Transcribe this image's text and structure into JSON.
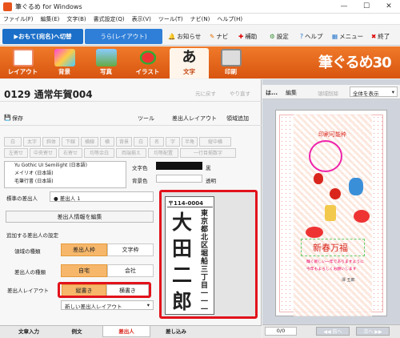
{
  "window": {
    "title": "筆ぐるめ for Windows",
    "min": "—",
    "max": "☐",
    "close": "✕"
  },
  "menu": [
    "ファイル(F)",
    "編集(E)",
    "文字(B)",
    "書式設定(Q)",
    "表示(V)",
    "ツール(T)",
    "ナビ(N)",
    "ヘルプ(H)"
  ],
  "modes": {
    "front": "▶おもて(宛名)へ切替",
    "back": "うら(レイアウト)"
  },
  "toplinks": [
    {
      "icon": "bell-icon",
      "label": "お知らせ"
    },
    {
      "icon": "navi-icon",
      "label": "ナビ"
    },
    {
      "icon": "plus-icon",
      "label": "補助"
    },
    {
      "icon": "gear-icon",
      "label": "設定"
    },
    {
      "icon": "help-icon",
      "label": "ヘルプ"
    },
    {
      "icon": "menu-icon",
      "label": "メニュー"
    },
    {
      "icon": "close-icon",
      "label": "終了"
    }
  ],
  "bigtools": [
    "レイアウト",
    "背景",
    "写真",
    "イラスト",
    "文字",
    "印刷"
  ],
  "logo": "筆ぐるめ30",
  "doc": {
    "title": "0129 通常年賀004",
    "undo": "元に戻す",
    "redo": "やり直す"
  },
  "toolbar": {
    "save": "保存",
    "tools": "ツール",
    "sender_layout": "差出人レイアウト",
    "add_area": "領域追加"
  },
  "format_row1": [
    "白",
    "太字",
    "斜体",
    "下線",
    "横線",
    "横",
    "背景",
    "白",
    "名",
    "字",
    "半角"
  ],
  "format_row1_extra": "縦中横",
  "format_row2": [
    "左寄せ",
    "中央寄せ",
    "右寄せ",
    "均等余白",
    "両端揃え",
    "均等配置"
  ],
  "format_row2_extra": "一行目揃数字",
  "fonts": [
    "Yu Gothic UI Semilight (日本語)",
    "メイリオ (日本語)",
    "毛筆行書 (日本語)"
  ],
  "color": {
    "text_label": "文字色",
    "text_value": "黒",
    "bg_label": "背景色",
    "bg_value": "透明"
  },
  "sender": {
    "std_label": "標準の差出人",
    "std_value": "差出人 1",
    "edit_btn": "差出人情報を編集",
    "settings_title": "追加する差出人の設定"
  },
  "area_type": {
    "label": "領域の種類",
    "options": [
      "差出人枠",
      "文字枠"
    ]
  },
  "sender_type": {
    "label": "差出人の種類",
    "options": [
      "自宅",
      "会社"
    ]
  },
  "sender_layout": {
    "label": "差出人レイアウト",
    "options": [
      "縦書き",
      "横書き"
    ],
    "new": "新しい差出人レイアウト"
  },
  "preview": {
    "postal": "〒114-0004",
    "address": "東京都北区堀船三丁目一一一",
    "name": [
      "大",
      "田",
      "二",
      "郎"
    ]
  },
  "bottom_tabs": [
    "文章入力",
    "例文",
    "差出人",
    "差し込み"
  ],
  "right": {
    "label": "は...",
    "edit": "編集",
    "delete": "領域削除",
    "view": "全体を表示",
    "printable": "印刷可能枠",
    "greeting": "新春万福",
    "msg1": "輝く新しい一年でありますように",
    "msg2": "今年もよろしくお願いします",
    "sender_small": "澤 五郎",
    "page": "0/0",
    "prev": "◀◀ 前へ",
    "next": "次へ ▶▶"
  }
}
